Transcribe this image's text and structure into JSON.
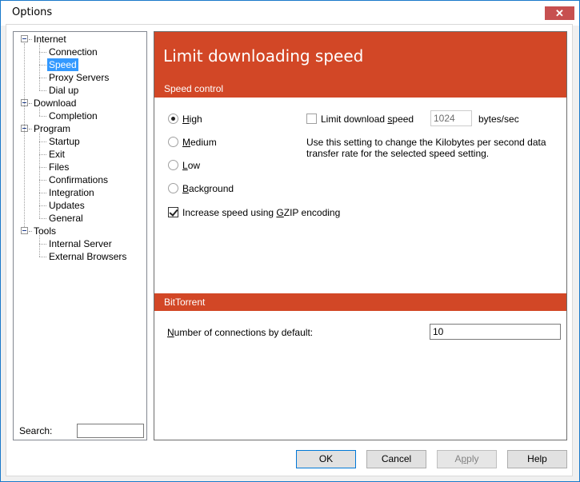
{
  "window": {
    "title": "Options",
    "close_glyph": "✕"
  },
  "tree": {
    "items": [
      {
        "label": "Internet",
        "level": 0,
        "expanded": true
      },
      {
        "label": "Connection",
        "level": 1
      },
      {
        "label": "Speed",
        "level": 1,
        "selected": true
      },
      {
        "label": "Proxy Servers",
        "level": 1
      },
      {
        "label": "Dial up",
        "level": 1
      },
      {
        "label": "Download",
        "level": 0,
        "expanded": true
      },
      {
        "label": "Completion",
        "level": 1
      },
      {
        "label": "Program",
        "level": 0,
        "expanded": true
      },
      {
        "label": "Startup",
        "level": 1
      },
      {
        "label": "Exit",
        "level": 1
      },
      {
        "label": "Files",
        "level": 1
      },
      {
        "label": "Confirmations",
        "level": 1
      },
      {
        "label": "Integration",
        "level": 1
      },
      {
        "label": "Updates",
        "level": 1
      },
      {
        "label": "General",
        "level": 1
      },
      {
        "label": "Tools",
        "level": 0,
        "expanded": true
      },
      {
        "label": "Internal Server",
        "level": 1
      },
      {
        "label": "External Browsers",
        "level": 1
      }
    ],
    "search_label": "Search:",
    "search_value": ""
  },
  "content": {
    "header_title": "Limit downloading speed",
    "speed_control": {
      "section_title": "Speed control",
      "radios": [
        {
          "accel": "H",
          "rest": "igh",
          "checked": true
        },
        {
          "accel": "M",
          "rest": "edium",
          "checked": false
        },
        {
          "accel": "L",
          "rest": "ow",
          "checked": false
        },
        {
          "accel": "B",
          "rest": "ackground",
          "checked": false
        }
      ],
      "gzip": {
        "pre": "Increase speed using ",
        "accel": "G",
        "post": "ZIP encoding",
        "checked": true
      },
      "limit": {
        "pre": "Limit download ",
        "accel": "s",
        "post": "peed",
        "checked": false
      },
      "limit_value": "1024",
      "limit_unit": "bytes/sec",
      "description": "Use this setting to change the Kilobytes per second data transfer rate for the selected speed setting."
    },
    "bittorrent": {
      "section_title": "BitTorrent",
      "connections_accel": "N",
      "connections_rest": "umber of connections by default:",
      "connections_value": "10"
    }
  },
  "buttons": {
    "ok": "OK",
    "cancel": "Cancel",
    "apply_pre": "A",
    "apply_accel": "p",
    "apply_post": "ply",
    "help": "Help"
  }
}
